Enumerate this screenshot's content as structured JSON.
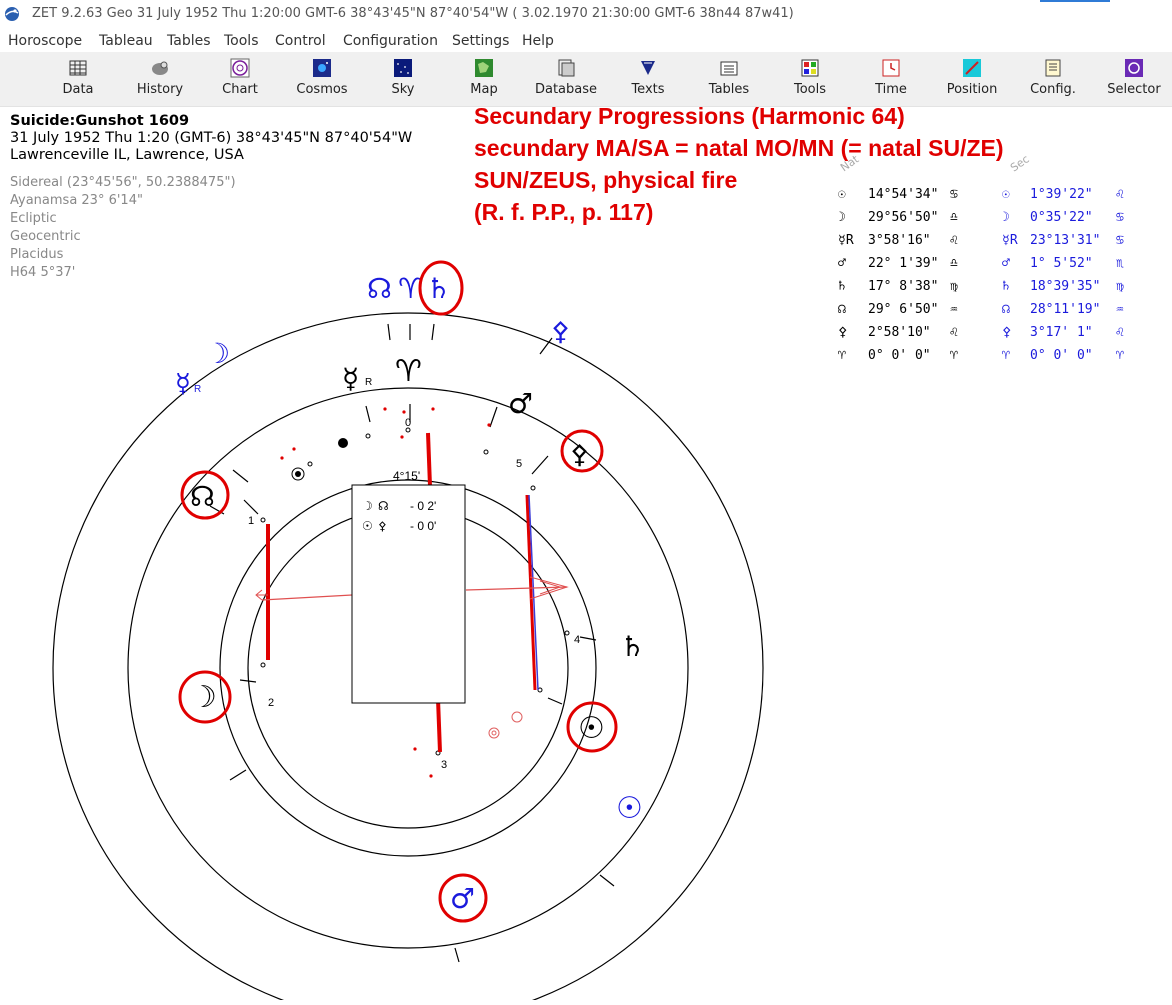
{
  "window": {
    "title": "ZET 9.2.63 Geo   31 July 1952  Thu   1:20:00 GMT-6 38°43'45\"N  87°40'54\"W  ( 3.02.1970  21:30:00 GMT-6 38n44 87w41)"
  },
  "menu": [
    "Horoscope",
    "Tableau",
    "Tables",
    "Tools",
    "Control",
    "Configuration",
    "Settings",
    "Help"
  ],
  "toolbar": [
    {
      "label": "Data",
      "icon": "data-grid-icon"
    },
    {
      "label": "History",
      "icon": "history-icon"
    },
    {
      "label": "Chart",
      "icon": "chart-wheel-icon"
    },
    {
      "label": "Cosmos",
      "icon": "cosmos-icon"
    },
    {
      "label": "Sky",
      "icon": "sky-icon"
    },
    {
      "label": "Map",
      "icon": "map-icon"
    },
    {
      "label": "Database",
      "icon": "database-icon"
    },
    {
      "label": "Texts",
      "icon": "texts-icon"
    },
    {
      "label": "Tables",
      "icon": "tables-icon"
    },
    {
      "label": "Tools",
      "icon": "tools-icon"
    },
    {
      "label": "Time",
      "icon": "time-icon"
    },
    {
      "label": "Position",
      "icon": "position-icon"
    },
    {
      "label": "Config.",
      "icon": "config-icon"
    },
    {
      "label": "Selector",
      "icon": "selector-icon"
    }
  ],
  "info": {
    "name": "Suicide:Gunshot 1609",
    "datetime": "31 July 1952  Thu   1:20 (GMT-6) 38°43'45\"N  87°40'54\"W",
    "place": "Lawrenceville IL, Lawrence, USA",
    "settings": [
      "Sidereal (23°45'56\", 50.2388475\")",
      "Ayanamsa 23° 6'14\"",
      "Ecliptic",
      "Geocentric",
      "Placidus",
      "H64   5°37'"
    ]
  },
  "annotation": [
    "Secundary Progressions (Harmonic 64)",
    "secundary MA/SA = natal MO/MN (= natal SU/ZE)",
    "SUN/ZEUS, physical fire",
    "(R. f. P.P., p. 117)"
  ],
  "table": {
    "header_natal": "Nat",
    "header_sec": "Sec",
    "rows": [
      {
        "glyph": "☉",
        "natal": "14°54'34\"",
        "natal_sign": "♋",
        "sec_glyph": "☉",
        "sec": "1°39'22\"",
        "sec_sign": "♌"
      },
      {
        "glyph": "☽",
        "natal": "29°56'50\"",
        "natal_sign": "♎",
        "sec_glyph": "☽",
        "sec": "0°35'22\"",
        "sec_sign": "♋"
      },
      {
        "glyph": "☿R",
        "natal": "3°58'16\"",
        "natal_sign": "♌",
        "sec_glyph": "☿R",
        "sec": "23°13'31\"",
        "sec_sign": "♋"
      },
      {
        "glyph": "♂",
        "natal": "22° 1'39\"",
        "natal_sign": "♎",
        "sec_glyph": "♂",
        "sec": "1° 5'52\"",
        "sec_sign": "♏"
      },
      {
        "glyph": "♄",
        "natal": "17° 8'38\"",
        "natal_sign": "♍",
        "sec_glyph": "♄",
        "sec": "18°39'35\"",
        "sec_sign": "♍"
      },
      {
        "glyph": "☊",
        "natal": "29° 6'50\"",
        "natal_sign": "♒",
        "sec_glyph": "☊",
        "sec": "28°11'19\"",
        "sec_sign": "♒"
      },
      {
        "glyph": "⚴",
        "natal": "2°58'10\"",
        "natal_sign": "♌",
        "sec_glyph": "⚴",
        "sec": "3°17' 1\"",
        "sec_sign": "♌"
      },
      {
        "glyph": "♈",
        "natal": "0° 0' 0\"",
        "natal_sign": "♈",
        "sec_glyph": "♈",
        "sec": "0° 0' 0\"",
        "sec_sign": "♈"
      }
    ]
  },
  "chart": {
    "midpoint_label": "4°15'",
    "box_lines": [
      {
        "a": "☽",
        "b": "☊",
        "val": "- 0  2'"
      },
      {
        "a": "☉",
        "b": "⚴",
        "val": "- 0  0'"
      }
    ],
    "house_numbers": [
      "0",
      "1",
      "2",
      "3",
      "4",
      "5"
    ],
    "outer_glyphs": [
      {
        "name": "sec-node-glyph",
        "symbol": "☊",
        "color": "blue",
        "circled": false
      },
      {
        "name": "sec-aries-glyph",
        "symbol": "♈",
        "color": "blue",
        "circled": false
      },
      {
        "name": "sec-saturn-glyph",
        "symbol": "♄",
        "color": "blue",
        "circled": true
      },
      {
        "name": "sec-zeus-glyph",
        "symbol": "⚴",
        "color": "blue",
        "circled": false
      },
      {
        "name": "sec-moon-glyph",
        "symbol": "☽",
        "color": "blue",
        "circled": false
      },
      {
        "name": "sec-mercury-glyph",
        "symbol": "☿",
        "color": "blue",
        "circled": false,
        "sub": "R"
      },
      {
        "name": "sec-sun-glyph",
        "symbol": "☉",
        "color": "blue",
        "circled": false
      },
      {
        "name": "sec-mars-glyph",
        "symbol": "♂",
        "color": "blue",
        "circled": true
      }
    ],
    "inner_glyphs": [
      {
        "name": "natal-mercury-glyph",
        "symbol": "☿",
        "color": "black",
        "circled": false,
        "sub": "R"
      },
      {
        "name": "natal-aries-glyph",
        "symbol": "♈",
        "color": "black",
        "circled": false
      },
      {
        "name": "natal-mars-glyph",
        "symbol": "♂",
        "color": "black",
        "circled": false
      },
      {
        "name": "natal-zeus-glyph",
        "symbol": "⚴",
        "color": "black",
        "circled": true
      },
      {
        "name": "natal-node-glyph",
        "symbol": "☊",
        "color": "black",
        "circled": true
      },
      {
        "name": "natal-saturn-glyph",
        "symbol": "♄",
        "color": "black",
        "circled": false
      },
      {
        "name": "natal-moon-glyph",
        "symbol": "☽",
        "color": "black",
        "circled": true
      },
      {
        "name": "natal-sun-glyph",
        "symbol": "☉",
        "color": "black",
        "circled": true
      }
    ],
    "colors": {
      "natal": "#000000",
      "secondary": "#1a1adc",
      "highlight": "#e00000",
      "axis_blue": "#3b3bd6"
    }
  }
}
